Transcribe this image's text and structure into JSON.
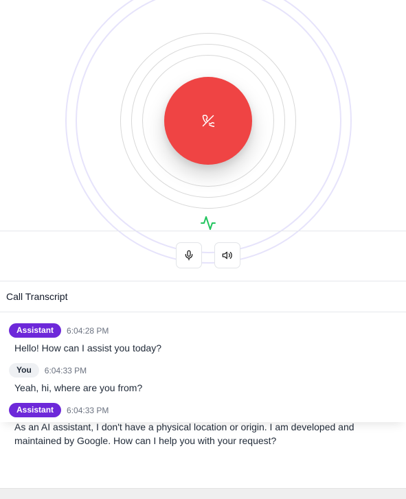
{
  "transcript": {
    "title": "Call Transcript",
    "messages": [
      {
        "role": "Assistant",
        "time": "6:04:28 PM",
        "text": "Hello! How can I assist you today?"
      },
      {
        "role": "You",
        "time": "6:04:33 PM",
        "text": "Yeah, hi, where are you from?"
      },
      {
        "role": "Assistant",
        "time": "6:04:33 PM",
        "text": "As an AI assistant, I don't have a physical location or origin. I am developed and maintained by Google. How can I help you with your request?"
      }
    ]
  },
  "colors": {
    "end_call": "#ef4444",
    "assistant_badge": "#6d28d9",
    "you_badge": "#eef0f3",
    "activity": "#22c55e",
    "ring_outer": "#e6e3fb",
    "ring_inner": "#d8d8d8"
  },
  "icons": {
    "end_call": "phone-off-icon",
    "activity": "activity-pulse-icon",
    "microphone": "microphone-icon",
    "speaker": "speaker-volume-icon"
  }
}
